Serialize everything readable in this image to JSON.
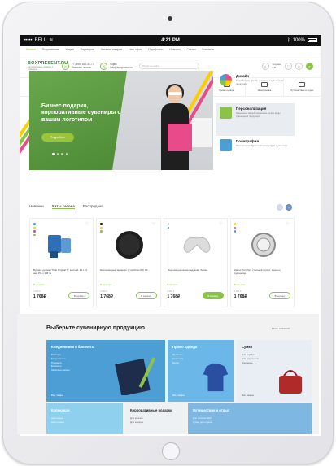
{
  "status_bar": {
    "carrier": "BELL",
    "time": "4:21 PM",
    "battery": "100%"
  },
  "top_nav": {
    "city": "Москва",
    "items": [
      "Москва",
      "Покупателям",
      "Услуги",
      "Партнерам",
      "Каталог товаров",
      "Наш офис",
      "Портфолио",
      "Новости",
      "Статьи",
      "Контакты"
    ]
  },
  "header": {
    "logo": "BOXPRESENT.RU",
    "logo_sub": "корпоративные подарки и сувениры",
    "phone": "+7 (495) 620-41-77",
    "phone_sub": "Заказать звонок",
    "email": "info@boxpresent.ru",
    "email_label": "Офис",
    "search_placeholder": "Поиск по сайту",
    "cart_label": "Корзина",
    "cart_sum": "0 ₽"
  },
  "categories": [
    "Новинки",
    "Сумки",
    "Календари",
    "Корпоративные подарки",
    "Ежедневники и блокноты",
    "Промо одежда",
    "Электроника",
    "Путешествие и отдых"
  ],
  "hero": {
    "title": "Бизнес подарки, корпоративные сувениры с вашим логотипом",
    "button": "Подробнее"
  },
  "side_items": [
    {
      "title": "Дизайн",
      "desc": "Разработаем дизайн подарков и сувенирной продукции"
    },
    {
      "title": "Персонализация",
      "desc": "Нанесение вашей символики на все виды сувенирной продукции"
    },
    {
      "title": "Полиграфия",
      "desc": "Изготовление бумажной полиграфии и упаковки"
    }
  ],
  "tabs": [
    "Новинки",
    "Хиты сезона",
    "Распродажа"
  ],
  "products": [
    {
      "name": "Вуговка детская \"Kids Original T\", желтый, 12 x 10 мм, 156 x 145 гм",
      "stock": "В наличии",
      "old_price": "2 950 ₽",
      "price": "1 768₽",
      "buy": "В корзину"
    },
    {
      "name": "Беспроводное зарядное устройство 8W, 80...",
      "stock": "В наличии",
      "old_price": "2 950 ₽",
      "price": "1 768₽",
      "buy": "В корзину"
    },
    {
      "name": "Подушка дорожная надувная, белая",
      "stock": "В наличии",
      "old_price": "2 950 ₽",
      "price": "1 768₽",
      "buy": "В корзину"
    },
    {
      "name": "Набор \"Голуба\", стальной корпус, зеркало, пудреница",
      "stock": "В наличии",
      "old_price": "2 950 ₽",
      "price": "1 768₽",
      "buy": "В корзину"
    }
  ],
  "section": {
    "title": "Выберите сувенирную продукцию",
    "link": "ВЕСЬ КАТАЛОГ",
    "tiles": [
      {
        "title": "Ежедневники и блокноты",
        "items": [
          "Blokhopp",
          "Ежедневники",
          "Планинги",
          "Блокноты",
          "Записные книжки"
        ],
        "more": "Все товары",
        "color": "#4e9ed6"
      },
      {
        "title": "Промо одежда",
        "items": [
          "Футболки",
          "Толстовки",
          "Кепки"
        ],
        "more": "Все товары",
        "color": "#6ab7e8"
      },
      {
        "title": "Сумки",
        "items": [
          "Для ноутбука",
          "Для документов",
          "Дорожные"
        ],
        "more": "Все товары",
        "color": "#e9eef4"
      },
      {
        "title": "Календари",
        "items": [
          "Настенные",
          "Настольные"
        ],
        "more": "",
        "color": "#8fd0ee"
      },
      {
        "title": "Корпоративные подарки",
        "items": [
          "Для мужчин",
          "Для женщин"
        ],
        "more": "",
        "color": "#5c6b85"
      },
      {
        "title": "Путешествие и отдых",
        "items": [
          "Для путешествий",
          "Сумки для отдыха"
        ],
        "more": "",
        "color": "#7fb7e3"
      }
    ]
  }
}
